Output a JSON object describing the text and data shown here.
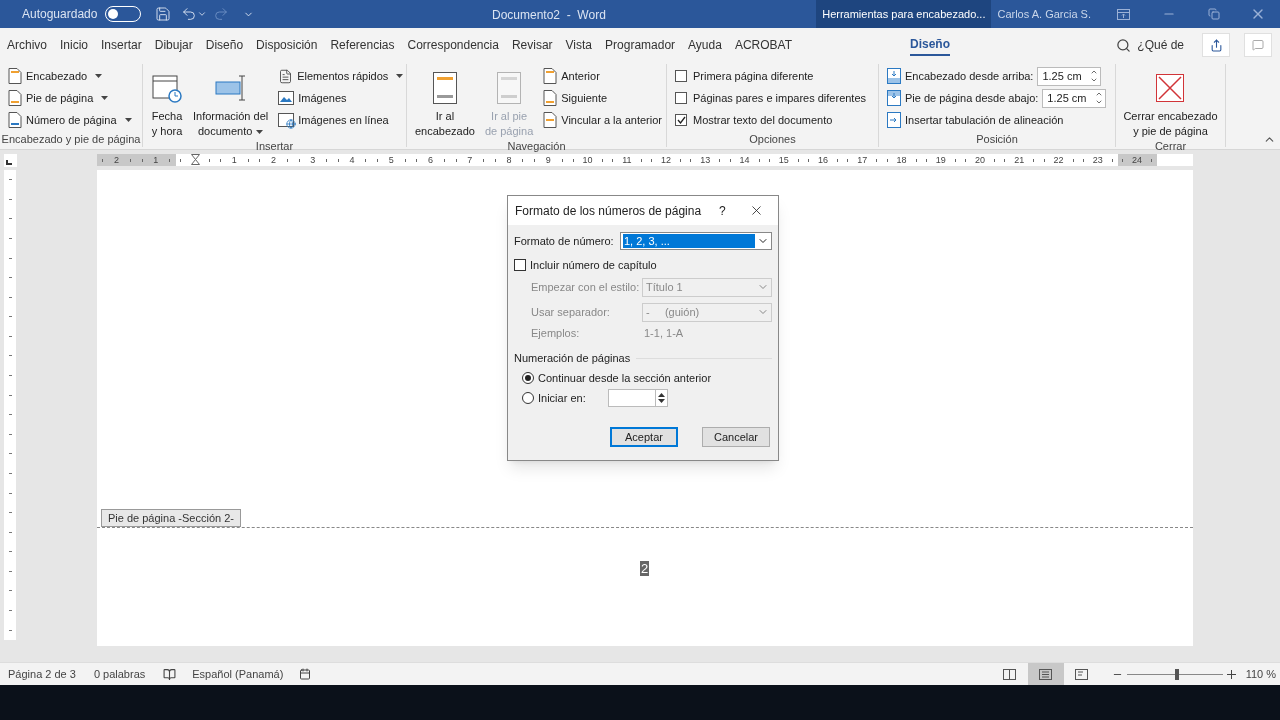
{
  "title_bar": {
    "autosave_label": "Autoguardado",
    "autosave_on": false,
    "title": "Documento2  -  Word",
    "context_tab": "Herramientas para encabezado...",
    "user": "Carlos A. Garcia S."
  },
  "menu_tabs": [
    {
      "label": "Archivo",
      "selected": false
    },
    {
      "label": "Inicio",
      "selected": false
    },
    {
      "label": "Insertar",
      "selected": false
    },
    {
      "label": "Dibujar",
      "selected": false
    },
    {
      "label": "Diseño",
      "selected": false
    },
    {
      "label": "Disposición",
      "selected": false
    },
    {
      "label": "Referencias",
      "selected": false
    },
    {
      "label": "Correspondencia",
      "selected": false
    },
    {
      "label": "Revisar",
      "selected": false
    },
    {
      "label": "Vista",
      "selected": false
    },
    {
      "label": "Programador",
      "selected": false
    },
    {
      "label": "Ayuda",
      "selected": false
    },
    {
      "label": "ACROBAT",
      "selected": false
    },
    {
      "label": "Diseño",
      "selected": true
    }
  ],
  "search_hint": "¿Qué de",
  "ribbon": [
    {
      "label": "Encabezado y pie de página",
      "columns": [
        [
          {
            "kind": "small",
            "label": "Encabezado",
            "dropdown": true,
            "disabled": false
          },
          {
            "kind": "small",
            "label": "Pie de página",
            "dropdown": true,
            "disabled": false
          },
          {
            "kind": "small",
            "label": "Número de página",
            "dropdown": true,
            "disabled": false
          }
        ]
      ]
    },
    {
      "label": "Insertar",
      "columns": [
        [
          {
            "kind": "large",
            "label": "Fecha\ny hora",
            "dropdown": false,
            "disabled": false
          }
        ],
        [
          {
            "kind": "large",
            "label": "Información del\ndocumento",
            "dropdown": true,
            "disabled": false
          }
        ],
        [
          {
            "kind": "small",
            "label": "Elementos rápidos",
            "dropdown": true,
            "disabled": false
          },
          {
            "kind": "small",
            "label": "Imágenes",
            "dropdown": false,
            "disabled": false
          },
          {
            "kind": "small",
            "label": "Imágenes en línea",
            "dropdown": false,
            "disabled": false
          }
        ]
      ]
    },
    {
      "label": "Navegación",
      "columns": [
        [
          {
            "kind": "large",
            "label": "Ir al\nencabezado",
            "dropdown": false,
            "disabled": false
          }
        ],
        [
          {
            "kind": "large",
            "label": "Ir al pie\nde página",
            "dropdown": false,
            "disabled": true
          }
        ],
        [
          {
            "kind": "small",
            "label": "Anterior",
            "dropdown": false,
            "disabled": false
          },
          {
            "kind": "small",
            "label": "Siguiente",
            "dropdown": false,
            "disabled": false
          },
          {
            "kind": "small",
            "label": "Vincular a la anterior",
            "dropdown": false,
            "disabled": false
          }
        ]
      ]
    },
    {
      "label": "Opciones",
      "columns": [
        [
          {
            "kind": "check",
            "label": "Primera página diferente",
            "checked": false
          },
          {
            "kind": "check",
            "label": "Páginas pares e impares diferentes",
            "checked": false
          },
          {
            "kind": "check",
            "label": "Mostrar texto del documento",
            "checked": true
          }
        ]
      ]
    },
    {
      "label": "Posición",
      "columns": [
        [
          {
            "kind": "spin",
            "label": "Encabezado desde arriba:",
            "value": "1.25 cm"
          },
          {
            "kind": "spin",
            "label": "Pie de página desde abajo:",
            "value": "1.25 cm"
          },
          {
            "kind": "small",
            "label": "Insertar tabulación de alineación",
            "dropdown": false,
            "disabled": false
          }
        ]
      ]
    },
    {
      "label": "Cerrar",
      "columns": [
        [
          {
            "kind": "large",
            "label": "Cerrar encabezado\ny pie de página",
            "dropdown": false,
            "disabled": false
          }
        ]
      ]
    }
  ],
  "ruler": [
    "2",
    "1",
    "1",
    "2",
    "3",
    "4",
    "5",
    "6",
    "7",
    "8",
    "9",
    "10",
    "11",
    "12",
    "13",
    "14",
    "15",
    "16",
    "17",
    "18",
    "19",
    "20",
    "21",
    "22",
    "23",
    "24"
  ],
  "footer_tag": "Pie de página -Sección 2-",
  "page_number": "2",
  "dialog": {
    "title": "Formato de los números de página",
    "help": "?",
    "format_label": "Formato de número:",
    "format_value": "1, 2, 3, ...",
    "include_chapter": {
      "label": "Incluir número de capítulo",
      "checked": false
    },
    "style_label": "Empezar con el estilo:",
    "style_value": "Título 1",
    "separator_label": "Usar separador:",
    "separator_value": "-     (guión)",
    "examples_label": "Ejemplos:",
    "examples_value": "1-1, 1-A",
    "numbering_heading": "Numeración de páginas",
    "numbering_options": [
      {
        "kind": "plain",
        "label": "Continuar desde la sección anterior",
        "selected": true
      },
      {
        "kind": "spin",
        "label": "Iniciar en:",
        "selected": false
      }
    ],
    "buttons": [
      {
        "label": "Aceptar",
        "default": true
      },
      {
        "label": "Cancelar",
        "default": false
      }
    ]
  },
  "status_bar": {
    "page": "Página 2 de 3",
    "words": "0 palabras",
    "language": "Español (Panamá)",
    "views": [
      {
        "selected": false
      },
      {
        "selected": true
      },
      {
        "selected": false
      }
    ],
    "zoom": {
      "level": 0.53
    },
    "zoom_reading": "110 %"
  }
}
